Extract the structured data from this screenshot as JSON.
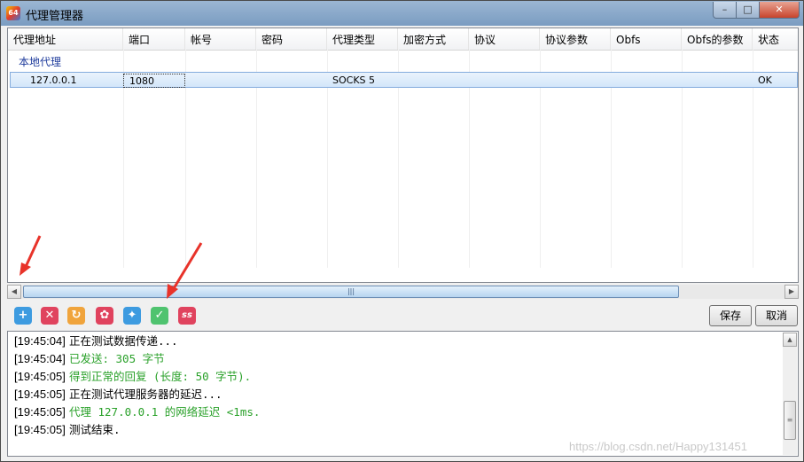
{
  "window": {
    "title": "代理管理器",
    "app_icon_text": "64"
  },
  "titlebar_buttons": {
    "minimize": "–",
    "maximize": "□",
    "close": "✕"
  },
  "table": {
    "columns": [
      "代理地址",
      "端口",
      "帐号",
      "密码",
      "代理类型",
      "加密方式",
      "协议",
      "协议参数",
      "Obfs",
      "Obfs的参数",
      "状态"
    ],
    "group": "本地代理",
    "rows": [
      {
        "address": "127.0.0.1",
        "port": "1080",
        "account": "",
        "password": "",
        "type": "SOCKS 5",
        "encryption": "",
        "protocol": "",
        "protocol_params": "",
        "obfs": "",
        "obfs_params": "",
        "status": "OK"
      }
    ]
  },
  "scrollbar": {
    "left_arrow": "◀",
    "right_arrow": "▶",
    "grip": "|||"
  },
  "toolbar": {
    "icons": [
      {
        "name": "add",
        "glyph": "+",
        "color": "#3d9be0"
      },
      {
        "name": "delete",
        "glyph": "✕",
        "color": "#e0435e"
      },
      {
        "name": "refresh",
        "glyph": "↻",
        "color": "#f0a43c"
      },
      {
        "name": "settings",
        "glyph": "✿",
        "color": "#e0435e"
      },
      {
        "name": "lightbulb",
        "glyph": "✦",
        "color": "#3d9be0"
      },
      {
        "name": "test-check",
        "glyph": "✓",
        "color": "#4fc36f"
      },
      {
        "name": "ss",
        "glyph": "ss",
        "color": "#e0435e"
      }
    ],
    "save_label": "保存",
    "cancel_label": "取消"
  },
  "log": {
    "lines": [
      {
        "time": "[19:45:04]",
        "text": "正在测试数据传递...",
        "color": "#000000"
      },
      {
        "time": "[19:45:04]",
        "text": "已发送: 305 字节",
        "color": "#2aa12a"
      },
      {
        "time": "[19:45:05]",
        "text": "得到正常的回复 (长度: 50 字节).",
        "color": "#2aa12a"
      },
      {
        "time": "[19:45:05]",
        "text": "正在测试代理服务器的延迟...",
        "color": "#000000"
      },
      {
        "time": "[19:45:05]",
        "text": "代理 127.0.0.1 的网络延迟 <1ms.",
        "color": "#2aa12a"
      },
      {
        "time": "[19:45:05]",
        "text": "测试结束.",
        "color": "#000000"
      }
    ]
  },
  "watermark": "https://blog.csdn.net/Happy131451",
  "annotation_color": "#e8332a"
}
